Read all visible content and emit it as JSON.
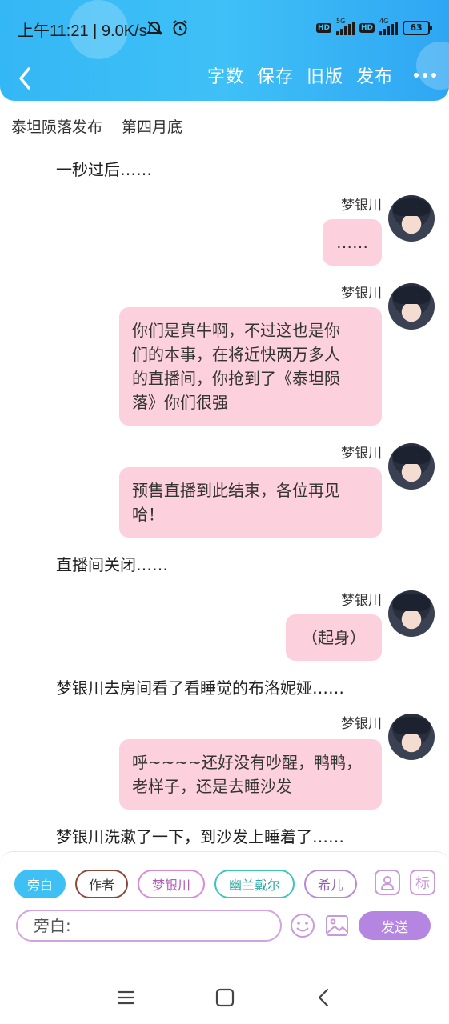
{
  "status_bar": {
    "time": "上午11:21",
    "speed": "9.0K/s",
    "signal1_label": "5G",
    "signal2_label": "4G",
    "battery": "63"
  },
  "navbar": {
    "word_count": "字数",
    "save": "保存",
    "old_version": "旧版",
    "publish": "发布"
  },
  "subtitle": {
    "title": "泰坦陨落发布",
    "chapter": "第四月底"
  },
  "story": {
    "narration1": "一秒过后……",
    "speaker": "梦银川",
    "msg1": "……",
    "msg2_line1": "你们是真牛啊，不过这也是你",
    "msg2_line2": "们的本事，在将近快两万多人",
    "msg2_line3": "的直播间，你抢到了《泰坦陨",
    "msg2_line4": "落》你们很强",
    "msg3_line1": "预售直播到此结束，各位再见",
    "msg3_line2": "哈！",
    "narration2": "直播间关闭……",
    "msg4": "（起身）",
    "narration3": "梦银川去房间看了看睡觉的布洛妮娅……",
    "msg5_line1": "呼~~~~还好没有吵醒，鸭鸭，",
    "msg5_line2": "老样子，还是去睡沙发",
    "narration4": "梦银川洗漱了一下，到沙发上睡着了……"
  },
  "panel": {
    "chips": [
      "旁白",
      "作者",
      "梦银川",
      "幽兰戴尔",
      "希儿"
    ],
    "mark_label": "标",
    "input_value": "旁白:",
    "send": "发送"
  },
  "colors": {
    "header": "#3fc0f6",
    "bubble": "#fdd0dd",
    "send": "#b486e2",
    "active_chip": "#3ec0f4"
  }
}
